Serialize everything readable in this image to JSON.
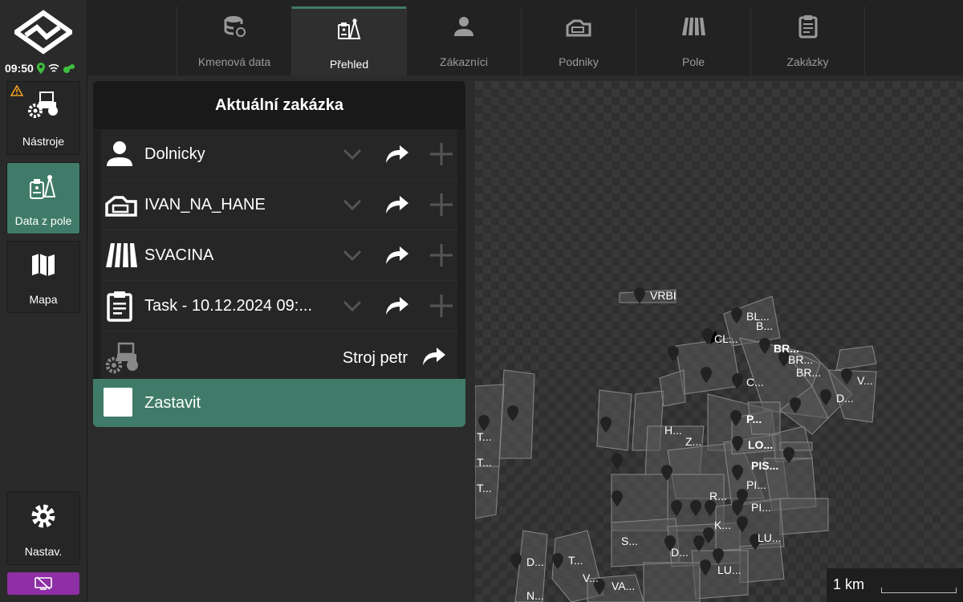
{
  "status": {
    "time": "09:50"
  },
  "sidebar": {
    "tools_label": "Nástroje",
    "data_label": "Data z pole",
    "map_label": "Mapa",
    "settings_label": "Nastav."
  },
  "tabs": [
    {
      "label": "Kmenová data",
      "icon": "database-icon"
    },
    {
      "label": "Přehled",
      "icon": "overview-icon",
      "active": true
    },
    {
      "label": "Zákazníci",
      "icon": "person-icon"
    },
    {
      "label": "Podniky",
      "icon": "farm-icon"
    },
    {
      "label": "Pole",
      "icon": "field-icon"
    },
    {
      "label": "Zakázky",
      "icon": "clipboard-icon"
    }
  ],
  "panel": {
    "title": "Aktuální zakázka",
    "rows": [
      {
        "icon": "person-icon",
        "text": "Dolnicky"
      },
      {
        "icon": "farm-icon",
        "text": "IVAN_NA_HANE"
      },
      {
        "icon": "field-icon",
        "text": "SVACINA"
      },
      {
        "icon": "clipboard-icon",
        "text": "Task - 10.12.2024 09:..."
      }
    ],
    "machine": {
      "icon": "tractor-icon",
      "text": "Stroj petr"
    },
    "stop_label": "Zastavit"
  },
  "map": {
    "scale_label": "1 km",
    "field_labels": [
      "VRBI",
      "BL...",
      "B...",
      "CL...",
      "BR...",
      "BR...",
      "BR...",
      "V...",
      "D...",
      "C...",
      "P...",
      "LO...",
      "PIS...",
      "PI...",
      "PI...",
      "LU...",
      "LU...",
      "R...",
      "K...",
      "H...",
      "Z...",
      "S...",
      "D...",
      "T...",
      "V...",
      "VA...",
      "D...",
      "T...",
      "T...",
      "T...",
      "N..."
    ]
  },
  "colors": {
    "accent": "#3f7b68",
    "warning": "#f0a020",
    "gps": "#3fbf3f",
    "screen_btn": "#8e2fa5"
  }
}
